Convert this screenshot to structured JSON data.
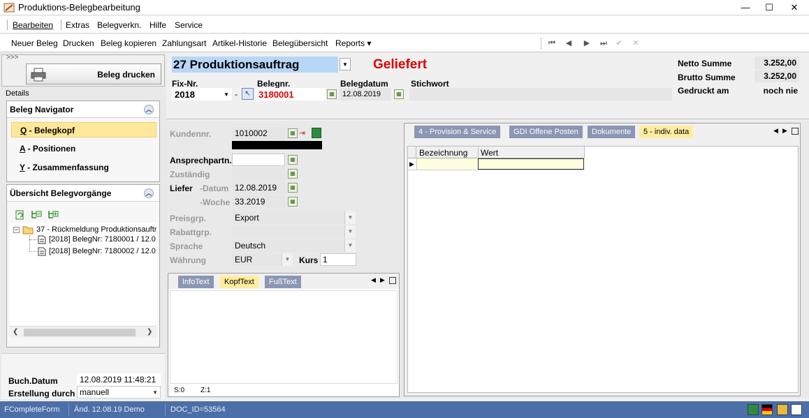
{
  "window": {
    "title": "Produktions-Belegbearbeitung",
    "minimize": "—",
    "maximize": "☐",
    "close": "✕"
  },
  "menu": [
    "Bearbeiten",
    "Extras",
    "Belegverkn.",
    "Hilfe",
    "Service"
  ],
  "toolbar": {
    "items": [
      "Neuer Beleg",
      "Drucken",
      "Beleg kopieren",
      "Zahlungsart",
      "Artikel-Historie",
      "Belegübersicht",
      "Reports ▾"
    ],
    "nav": [
      "⏮",
      "◀",
      "▶",
      "⏭",
      "✔",
      "✕"
    ]
  },
  "left": {
    "chevrons": ">>>",
    "print_button": "Beleg drucken",
    "details_label": "Details",
    "navigator": {
      "title": "Beleg Navigator",
      "items": [
        {
          "key": "Q",
          "label": " - Belegkopf"
        },
        {
          "key": "A",
          "label": " - Positionen"
        },
        {
          "key": "Y",
          "label": " - Zusammenfassung"
        }
      ]
    },
    "overview": {
      "title": "Übersicht Belegvorgänge",
      "tree_root": "37 - Rückmeldung Produktionsauftr",
      "tree_children": [
        "[2018] BelegNr: 7180001 / 12.0",
        "[2018] BelegNr: 7180002 / 12.0"
      ]
    },
    "buch_datum_label": "Buch.Datum",
    "buch_datum_value": "12.08.2019 11:48:21",
    "erstellung_label": "Erstellung durch",
    "erstellung_value": "manuell"
  },
  "header": {
    "doc_type": "27 Produktionsauftrag",
    "status": "Geliefert",
    "status_color": "#e00000",
    "fix_label": "Fix-Nr.",
    "fix_value": "2018",
    "dash": "-",
    "belegnr_label": "Belegnr.",
    "belegnr_value": "3180001",
    "belegdatum_label": "Belegdatum",
    "belegdatum_value": "12.08.2019",
    "stichwort_label": "Stichwort",
    "netto_label": "Netto Summe",
    "netto_value": "3.252,00",
    "brutto_label": "Brutto Summe",
    "brutto_value": "3.252,00",
    "gedruckt_label": "Gedruckt am",
    "gedruckt_value": "noch nie"
  },
  "form": {
    "kundennr_label": "Kundennr.",
    "kundennr_value": "1010002",
    "ansprech_label": "Ansprechpartn.",
    "zustaendig_label": "Zuständig",
    "liefer_label": "Liefer",
    "datum_label": "-Datum",
    "datum_value": "12.08.2019",
    "woche_label": "-Woche",
    "woche_value": "33.2019",
    "preisgrp_label": "Preisgrp.",
    "preisgrp_value": "Export",
    "rabattgrp_label": "Rabattgrp.",
    "sprache_label": "Sprache",
    "sprache_value": "Deutsch",
    "waehrung_label": "Währung",
    "waehrung_value": "EUR",
    "kurs_label": "Kurs",
    "kurs_value": "1",
    "text_tabs": [
      "InfoText",
      "KopfText",
      "FußText"
    ],
    "text_active": 1,
    "status_s": "S:0",
    "status_z": "Z:1"
  },
  "right": {
    "tabs": [
      "4 - Provision & Service",
      "GDI Offene Posten",
      "Dokumente",
      "5 - indiv. data"
    ],
    "active_tab": 3,
    "grid_cols": [
      "Bezeichnung",
      "Wert"
    ]
  },
  "statusbar": {
    "form": "FCompleteForm",
    "changed": "Änd. 12.08.19 Demo",
    "doc_id": "DOC_ID=53564"
  }
}
